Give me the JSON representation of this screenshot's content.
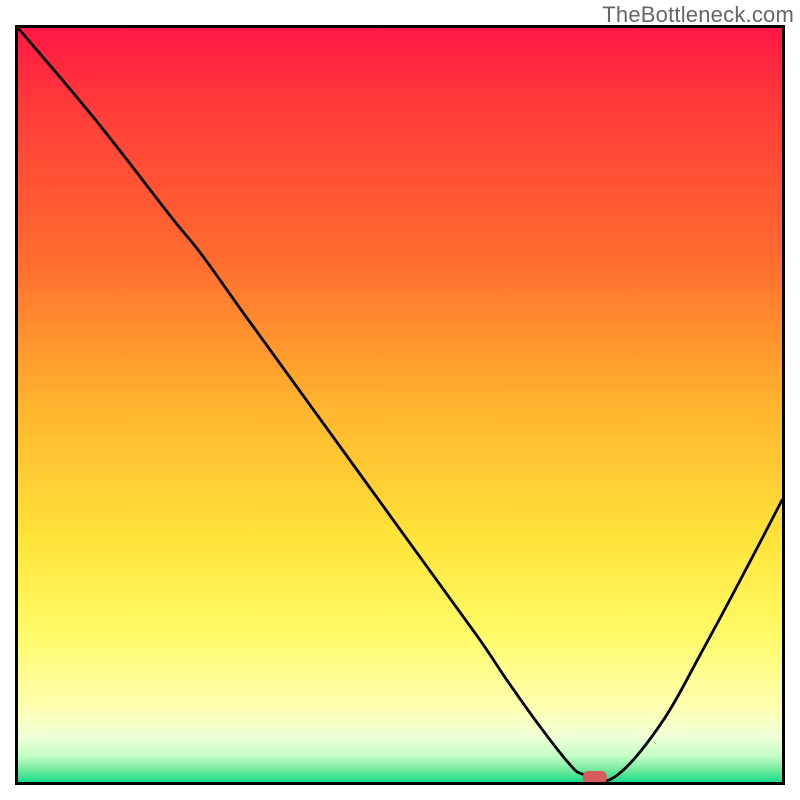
{
  "watermark": "TheBottleneck.com",
  "chart_data": {
    "type": "line",
    "title": "",
    "xlabel": "",
    "ylabel": "",
    "x_range": [
      0,
      100
    ],
    "y_range": [
      0,
      100
    ],
    "legend": false,
    "grid": false,
    "background_gradient": {
      "stops": [
        {
          "offset": 0.0,
          "color": "#ff1744"
        },
        {
          "offset": 0.1,
          "color": "#ff3a3a"
        },
        {
          "offset": 0.3,
          "color": "#ff6a2f"
        },
        {
          "offset": 0.5,
          "color": "#ffb42e"
        },
        {
          "offset": 0.68,
          "color": "#ffe43a"
        },
        {
          "offset": 0.8,
          "color": "#fffb66"
        },
        {
          "offset": 0.9,
          "color": "#ffffb0"
        },
        {
          "offset": 0.94,
          "color": "#eeffd8"
        },
        {
          "offset": 0.965,
          "color": "#c6ffc6"
        },
        {
          "offset": 0.985,
          "color": "#6de89a"
        },
        {
          "offset": 1.0,
          "color": "#18dd8e"
        }
      ]
    },
    "series": [
      {
        "name": "bottleneck-curve",
        "x": [
          0.0,
          10,
          20,
          24,
          30,
          40,
          50,
          60,
          64,
          68,
          72,
          74,
          78,
          84,
          90,
          96,
          100
        ],
        "y": [
          100,
          88,
          75,
          70,
          61.5,
          47.5,
          33.5,
          19.5,
          13.5,
          7.8,
          2.6,
          1.0,
          0.6,
          7.5,
          18.2,
          29.6,
          37.4
        ]
      }
    ],
    "marker": {
      "name": "optimum-point",
      "x": 75.5,
      "y": 0.6,
      "color": "#d85a5a",
      "shape": "rounded-rect",
      "width": 3.0,
      "height": 1.6
    }
  }
}
